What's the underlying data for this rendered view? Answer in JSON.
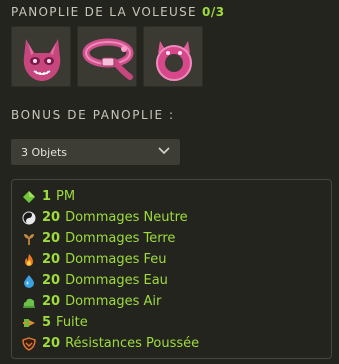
{
  "set": {
    "title": "PANOPLIE DE LA VOLEUSE",
    "count": "0/3",
    "items": [
      {
        "name": "mask",
        "icon": "cat-mask-icon"
      },
      {
        "name": "belt",
        "icon": "belt-icon"
      },
      {
        "name": "ring",
        "icon": "cat-ring-icon"
      }
    ]
  },
  "bonus": {
    "heading": "BONUS DE PANOPLIE :",
    "selector_value": "3 Objets",
    "rows": [
      {
        "value": "1",
        "label": "PM",
        "icon": "pm-diamond-icon",
        "color": "#6fc63a"
      },
      {
        "value": "20",
        "label": "Dommages Neutre",
        "icon": "neutral-yinyang-icon",
        "color": "#e8e8e8"
      },
      {
        "value": "20",
        "label": "Dommages Terre",
        "icon": "earth-sprout-icon",
        "color": "#b07a3a"
      },
      {
        "value": "20",
        "label": "Dommages Feu",
        "icon": "fire-flame-icon",
        "color": "#f07a20"
      },
      {
        "value": "20",
        "label": "Dommages Eau",
        "icon": "water-drop-icon",
        "color": "#3aa0e0"
      },
      {
        "value": "20",
        "label": "Dommages Air",
        "icon": "air-cloud-icon",
        "color": "#6cc04a"
      },
      {
        "value": "5",
        "label": "Fuite",
        "icon": "flee-icon",
        "color": "#e08a30"
      },
      {
        "value": "20",
        "label": "Résistances Poussée",
        "icon": "pushback-shield-icon",
        "color": "#e07830"
      }
    ]
  },
  "colors": {
    "accent_green": "#9ddc3c",
    "background": "#24241f",
    "slot_bg": "#3a3a33"
  }
}
